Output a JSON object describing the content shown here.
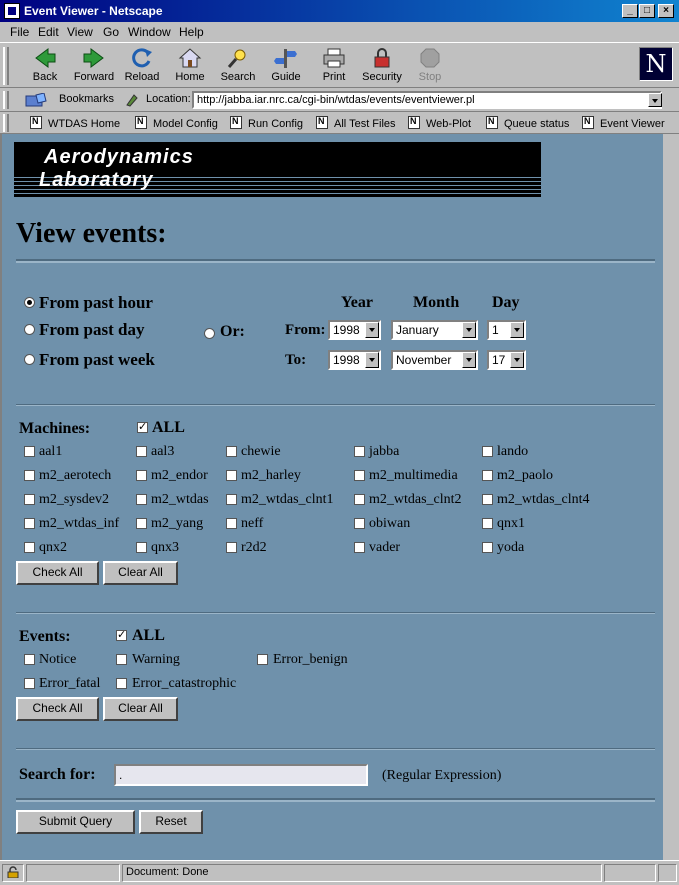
{
  "window": {
    "title": "Event Viewer - Netscape"
  },
  "menu": [
    "File",
    "Edit",
    "View",
    "Go",
    "Window",
    "Help"
  ],
  "toolbar": [
    "Back",
    "Forward",
    "Reload",
    "Home",
    "Search",
    "Guide",
    "Print",
    "Security",
    "Stop"
  ],
  "location": {
    "bookmarks_label": "Bookmarks",
    "location_label": "Location:",
    "url": "http://jabba.iar.nrc.ca/cgi-bin/wtdas/events/eventviewer.pl"
  },
  "personal": [
    "WTDAS Home",
    "Model Config",
    "Run Config",
    "All Test Files",
    "Web-Plot",
    "Queue status",
    "Event Viewer"
  ],
  "banner": {
    "line1": "Aerodynamics",
    "line2": "Laboratory"
  },
  "page": {
    "heading": "View events:"
  },
  "time": {
    "options": [
      "From past hour",
      "From past day",
      "From past week"
    ],
    "selected": "From past hour",
    "or_label": "Or:",
    "col_year": "Year",
    "col_month": "Month",
    "col_day": "Day",
    "from_label": "From:",
    "to_label": "To:",
    "from": {
      "year": "1998",
      "month": "January",
      "day": "1"
    },
    "to": {
      "year": "1998",
      "month": "November",
      "day": "17"
    }
  },
  "machines": {
    "label": "Machines:",
    "all_label": "ALL",
    "all_checked": true,
    "items": [
      "aal1",
      "aal3",
      "chewie",
      "jabba",
      "lando",
      "m2_aerotech",
      "m2_endor",
      "m2_harley",
      "m2_multimedia",
      "m2_paolo",
      "m2_sysdev2",
      "m2_wtdas",
      "m2_wtdas_clnt1",
      "m2_wtdas_clnt2",
      "m2_wtdas_clnt4",
      "m2_wtdas_inf",
      "m2_yang",
      "neff",
      "obiwan",
      "qnx1",
      "qnx2",
      "qnx3",
      "r2d2",
      "vader",
      "yoda"
    ],
    "check_all": "Check All",
    "clear_all": "Clear All"
  },
  "events": {
    "label": "Events:",
    "all_label": "ALL",
    "all_checked": true,
    "items": [
      "Notice",
      "Warning",
      "Error_benign",
      "Error_fatal",
      "Error_catastrophic"
    ],
    "check_all": "Check All",
    "clear_all": "Clear All"
  },
  "search": {
    "label": "Search for:",
    "value": ".",
    "hint": "(Regular Expression)"
  },
  "form": {
    "submit": "Submit Query",
    "reset": "Reset"
  },
  "status": {
    "text": "Document: Done"
  },
  "colors": {
    "page_bg": "#6f91ab",
    "chrome": "#c0c0c0",
    "title_bar": "#000080"
  },
  "icons": [
    "netscape-n-icon",
    "back-arrow-icon",
    "forward-arrow-icon",
    "reload-icon",
    "home-icon",
    "search-icon",
    "guide-icon",
    "print-icon",
    "security-lock-icon",
    "stop-icon",
    "bookmark-icon",
    "location-icon",
    "padlock-icon"
  ]
}
